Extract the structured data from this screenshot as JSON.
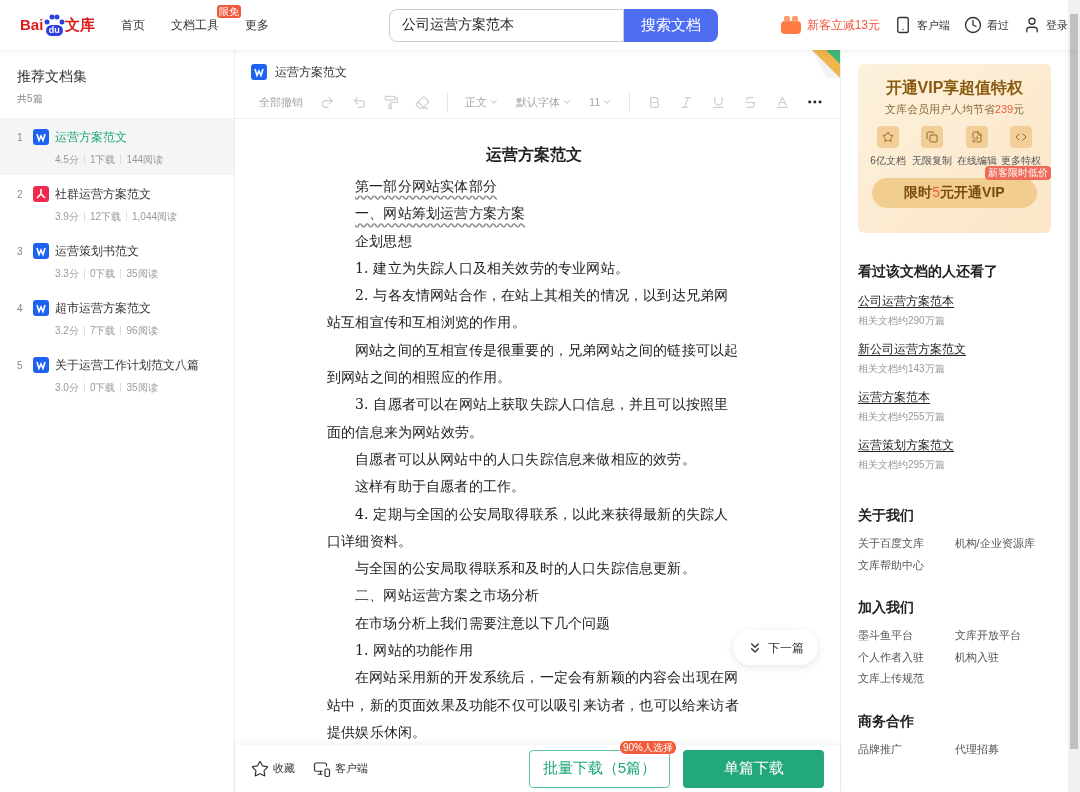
{
  "header": {
    "logo": {
      "before": "Bai",
      "paw": "du",
      "after": "文库"
    },
    "nav": [
      {
        "label": "首页"
      },
      {
        "label": "文档工具",
        "badge": "限免"
      },
      {
        "label": "更多"
      }
    ],
    "search": {
      "value": "公司运营方案范本",
      "button": "搜索文档"
    },
    "promo": "新客立减13元",
    "actions": [
      {
        "kind": "phone",
        "label": "客户端"
      },
      {
        "kind": "clock",
        "label": "看过"
      },
      {
        "kind": "user",
        "label": "登录"
      }
    ]
  },
  "sidebar": {
    "title": "推荐文档集",
    "count": "共5篇",
    "items": [
      {
        "index": "1",
        "kind": "word",
        "title": "运营方案范文",
        "score": "4.5分",
        "downloads": "1下载",
        "reads": "144阅读",
        "selected": true
      },
      {
        "index": "2",
        "kind": "pdf",
        "title": "社群运营方案范文",
        "score": "3.9分",
        "downloads": "12下载",
        "reads": "1,044阅读",
        "selected": false
      },
      {
        "index": "3",
        "kind": "word",
        "title": "运营策划书范文",
        "score": "3.3分",
        "downloads": "0下载",
        "reads": "35阅读",
        "selected": false
      },
      {
        "index": "4",
        "kind": "word",
        "title": "超市运营方案范文",
        "score": "3.2分",
        "downloads": "7下载",
        "reads": "96阅读",
        "selected": false
      },
      {
        "index": "5",
        "kind": "word",
        "title": "关于运营工作计划范文八篇",
        "score": "3.0分",
        "downloads": "0下载",
        "reads": "35阅读",
        "selected": false
      }
    ]
  },
  "document": {
    "name": "运营方案范文",
    "toolbar": [
      {
        "kind": "text",
        "label": "全部撤销"
      },
      {
        "kind": "redo"
      },
      {
        "kind": "undo"
      },
      {
        "kind": "painter"
      },
      {
        "kind": "eraser"
      },
      {
        "kind": "divider"
      },
      {
        "kind": "dropdown",
        "label": "正文"
      },
      {
        "kind": "dropdown",
        "label": "默认字体"
      },
      {
        "kind": "dropdown",
        "label": "11"
      },
      {
        "kind": "divider"
      },
      {
        "kind": "bold"
      },
      {
        "kind": "italic"
      },
      {
        "kind": "underline"
      },
      {
        "kind": "strike"
      },
      {
        "kind": "color"
      }
    ],
    "title": "运营方案范文",
    "paragraphs": [
      {
        "kind": "wavy",
        "text": "第一部分网站实体部分"
      },
      {
        "kind": "wavy",
        "text": "一、网站筹划运营方案方案"
      },
      {
        "kind": "body",
        "text": "企划思想"
      },
      {
        "kind": "body",
        "text": "1. 建立为失踪人口及相关效劳的专业网站。"
      },
      {
        "kind": "body",
        "text": "2. 与各友情网站合作，在站上其相关的情况，以到达兄弟网站互相宣传和互相浏览的作用。"
      },
      {
        "kind": "body",
        "text": "网站之间的互相宣传是很重要的，兄弟网站之间的链接可以起到网站之间的相照应的作用。"
      },
      {
        "kind": "body",
        "text": "3. 自愿者可以在网站上获取失踪人口信息，并且可以按照里面的信息来为网站效劳。"
      },
      {
        "kind": "body",
        "text": "自愿者可以从网站中的人口失踪信息来做相应的效劳。"
      },
      {
        "kind": "body",
        "text": "这样有助于自愿者的工作。"
      },
      {
        "kind": "body",
        "text": "4. 定期与全国的公安局取得联系，以此来获得最新的失踪人口详细资料。"
      },
      {
        "kind": "body",
        "text": "与全国的公安局取得联系和及时的人口失踪信息更新。"
      },
      {
        "kind": "body",
        "text": "二、网站运营方案之市场分析"
      },
      {
        "kind": "body",
        "text": "在市场分析上我们需要注意以下几个问题"
      },
      {
        "kind": "body",
        "text": "1. 网站的功能作用"
      },
      {
        "kind": "body",
        "text": "在网站采用新的开发系统后，一定会有新颖的内容会出现在网站中，新的页面效果及功能不仅可以吸引来访者，也可以给来访者提供娱乐休闲。"
      }
    ],
    "next": "下一篇"
  },
  "bottom_bar": {
    "links": [
      {
        "kind": "star",
        "label": "收藏"
      },
      {
        "kind": "monitor",
        "label": "客户端"
      }
    ],
    "batch": {
      "label": "批量下载（5篇）",
      "badge": "90%人选择"
    },
    "single": "单篇下载"
  },
  "vip": {
    "title": "开通VIP享超值特权",
    "subtitle": "文库会员用户人均节省**239**元",
    "perks": [
      {
        "kind": "star",
        "label": "6亿文档"
      },
      {
        "kind": "copy",
        "label": "无限复制"
      },
      {
        "kind": "edit",
        "label": "在线编辑"
      },
      {
        "kind": "code",
        "label": "更多特权"
      }
    ],
    "button": "限时**5**元开通VIP",
    "badge": "新客限时低价"
  },
  "related": {
    "title": "看过该文档的人还看了",
    "items": [
      {
        "title": "公司运营方案范本",
        "meta": "相关文档约290万篇"
      },
      {
        "title": "新公司运营方案范文",
        "meta": "相关文档约143万篇"
      },
      {
        "title": "运营方案范本",
        "meta": "相关文档约255万篇"
      },
      {
        "title": "运营策划方案范文",
        "meta": "相关文档约295万篇"
      }
    ]
  },
  "footer": [
    {
      "title": "关于我们",
      "links": [
        "关于百度文库",
        "机构/企业资源库",
        "文库帮助中心"
      ]
    },
    {
      "title": "加入我们",
      "links": [
        "墨斗鱼平台",
        "文库开放平台",
        "个人作者入驻",
        "机构入驻",
        "文库上传规范"
      ]
    },
    {
      "title": "商务合作",
      "links": [
        "品牌推广",
        "代理招募"
      ]
    }
  ]
}
